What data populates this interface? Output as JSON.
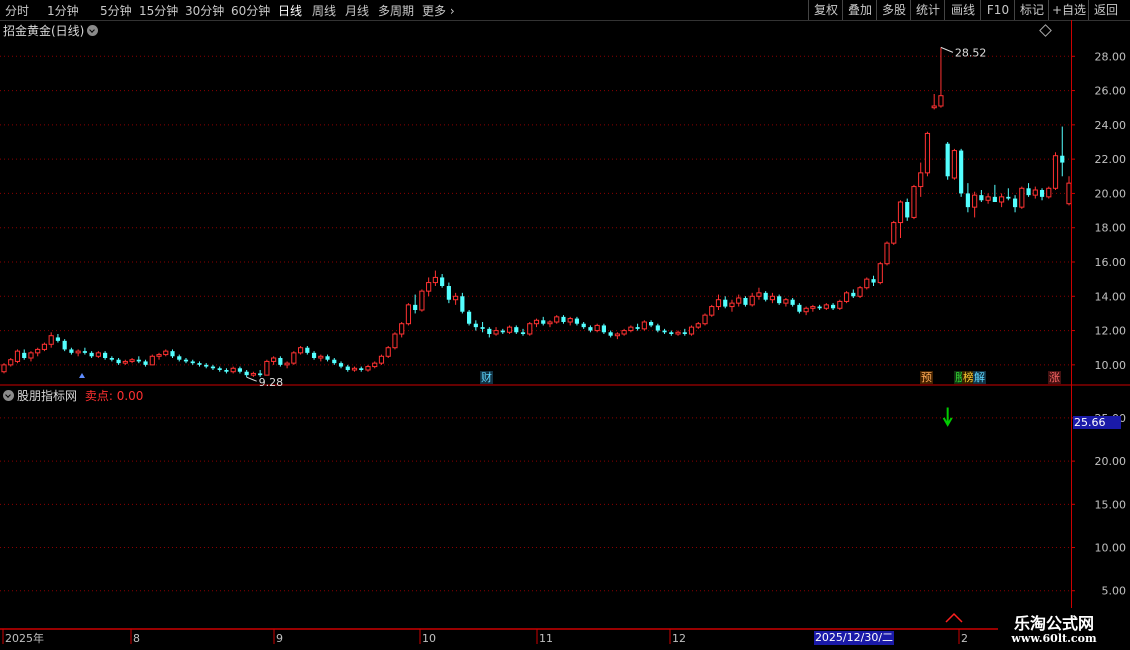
{
  "toolbar": {
    "left_items": [
      "分时",
      "1分钟",
      "5分钟",
      "15分钟",
      "30分钟",
      "60分钟",
      "日线",
      "周线",
      "月线",
      "多周期",
      "更多"
    ],
    "more_icon": "chevron-right-icon",
    "active": "日线",
    "right_items": [
      "复权",
      "叠加",
      "多股",
      "统计",
      "画线",
      "F10",
      "标记",
      "+自选",
      "返回"
    ]
  },
  "colors": {
    "up": "#ff3232",
    "down": "#54ffff",
    "grid": "#8b0000",
    "axis_text": "#c0c0c0",
    "sell_arrow": "#00cc00",
    "indicator_label": "#ff3030"
  },
  "main_panel": {
    "title": "招金黄金(日线)",
    "title_icon": "chevron-down-icon",
    "peak_label": "28.52",
    "low_label": "9.28",
    "right_icon": "diamond-icon"
  },
  "indicator_panel": {
    "name": "股朋指标网",
    "name_icon": "chevron-down-icon",
    "value_label": "卖点: 0.00",
    "current_value_tag": "25.66"
  },
  "event_badges": [
    {
      "text": "财",
      "color": "#5fd7ff"
    },
    {
      "text": "预",
      "color": "#ff9933"
    },
    {
      "text": "股",
      "color": "#33cc33"
    },
    {
      "text": "榜",
      "color": "#ffcc33"
    },
    {
      "text": "解",
      "color": "#5fd7ff"
    },
    {
      "text": "涨",
      "color": "#ff4444"
    }
  ],
  "time_axis": {
    "labels": [
      "2025年",
      "8",
      "9",
      "10",
      "11",
      "12",
      "2"
    ],
    "selected_date": "2025/12/30/二"
  },
  "watermark": {
    "title": "乐淘公式网",
    "url": "www.60lt.com"
  },
  "chart_data": [
    {
      "type": "candlestick",
      "title": "招金黄金(日线)",
      "ylim": [
        9,
        30
      ],
      "yticks": [
        10,
        12,
        14,
        16,
        18,
        20,
        22,
        24,
        26,
        28
      ],
      "ytick_labels": [
        "10.00",
        "12.00",
        "14.00",
        "16.00",
        "18.00",
        "20.00",
        "22.00",
        "24.00",
        "26.00",
        "28.00"
      ],
      "grid": true,
      "annotations": [
        {
          "label": "28.52",
          "value": 28.52
        },
        {
          "label": "9.28",
          "value": 9.28
        }
      ],
      "ohlc": [
        [
          9.6,
          10.1,
          9.5,
          10.0
        ],
        [
          10.0,
          10.4,
          9.9,
          10.3
        ],
        [
          10.2,
          10.9,
          10.1,
          10.8
        ],
        [
          10.7,
          10.9,
          10.3,
          10.4
        ],
        [
          10.4,
          10.8,
          10.2,
          10.7
        ],
        [
          10.7,
          11.0,
          10.5,
          10.9
        ],
        [
          10.9,
          11.3,
          10.8,
          11.2
        ],
        [
          11.2,
          11.9,
          11.0,
          11.7
        ],
        [
          11.6,
          11.8,
          11.3,
          11.4
        ],
        [
          11.4,
          11.5,
          10.8,
          10.9
        ],
        [
          10.9,
          11.0,
          10.6,
          10.7
        ],
        [
          10.7,
          10.9,
          10.5,
          10.8
        ],
        [
          10.8,
          11.0,
          10.6,
          10.7
        ],
        [
          10.7,
          10.8,
          10.4,
          10.5
        ],
        [
          10.5,
          10.8,
          10.4,
          10.7
        ],
        [
          10.7,
          10.8,
          10.3,
          10.4
        ],
        [
          10.4,
          10.5,
          10.2,
          10.3
        ],
        [
          10.3,
          10.4,
          10.0,
          10.1
        ],
        [
          10.1,
          10.3,
          10.0,
          10.2
        ],
        [
          10.2,
          10.4,
          10.1,
          10.3
        ],
        [
          10.3,
          10.5,
          10.1,
          10.2
        ],
        [
          10.2,
          10.3,
          9.9,
          10.0
        ],
        [
          10.0,
          10.6,
          10.0,
          10.5
        ],
        [
          10.5,
          10.7,
          10.3,
          10.6
        ],
        [
          10.6,
          10.9,
          10.5,
          10.8
        ],
        [
          10.8,
          10.9,
          10.4,
          10.5
        ],
        [
          10.5,
          10.6,
          10.2,
          10.3
        ],
        [
          10.3,
          10.4,
          10.1,
          10.2
        ],
        [
          10.2,
          10.3,
          10.0,
          10.1
        ],
        [
          10.1,
          10.2,
          9.9,
          10.0
        ],
        [
          10.0,
          10.1,
          9.8,
          9.9
        ],
        [
          9.9,
          10.0,
          9.7,
          9.8
        ],
        [
          9.8,
          9.9,
          9.6,
          9.7
        ],
        [
          9.7,
          9.8,
          9.5,
          9.6
        ],
        [
          9.6,
          9.9,
          9.5,
          9.8
        ],
        [
          9.8,
          9.9,
          9.5,
          9.6
        ],
        [
          9.6,
          9.7,
          9.28,
          9.4
        ],
        [
          9.4,
          9.6,
          9.3,
          9.5
        ],
        [
          9.5,
          9.7,
          9.3,
          9.4
        ],
        [
          9.4,
          10.3,
          9.4,
          10.2
        ],
        [
          10.2,
          10.5,
          10.0,
          10.4
        ],
        [
          10.4,
          10.5,
          9.9,
          10.0
        ],
        [
          10.0,
          10.2,
          9.8,
          10.1
        ],
        [
          10.1,
          10.8,
          10.0,
          10.7
        ],
        [
          10.7,
          11.1,
          10.6,
          11.0
        ],
        [
          11.0,
          11.1,
          10.6,
          10.7
        ],
        [
          10.7,
          10.8,
          10.3,
          10.4
        ],
        [
          10.4,
          10.6,
          10.2,
          10.5
        ],
        [
          10.5,
          10.6,
          10.2,
          10.3
        ],
        [
          10.3,
          10.4,
          10.0,
          10.1
        ],
        [
          10.1,
          10.2,
          9.8,
          9.9
        ],
        [
          9.9,
          10.0,
          9.6,
          9.7
        ],
        [
          9.7,
          9.9,
          9.6,
          9.8
        ],
        [
          9.8,
          9.9,
          9.6,
          9.7
        ],
        [
          9.7,
          10.0,
          9.6,
          9.9
        ],
        [
          9.9,
          10.2,
          9.8,
          10.1
        ],
        [
          10.1,
          10.6,
          10.0,
          10.5
        ],
        [
          10.5,
          11.1,
          10.4,
          11.0
        ],
        [
          11.0,
          11.9,
          10.9,
          11.8
        ],
        [
          11.8,
          12.5,
          11.6,
          12.4
        ],
        [
          12.4,
          13.6,
          12.3,
          13.5
        ],
        [
          13.5,
          14.1,
          13.0,
          13.2
        ],
        [
          13.2,
          14.4,
          13.1,
          14.3
        ],
        [
          14.3,
          15.1,
          14.0,
          14.8
        ],
        [
          14.8,
          15.5,
          14.6,
          15.1
        ],
        [
          15.1,
          15.3,
          14.5,
          14.6
        ],
        [
          14.6,
          14.8,
          13.6,
          13.8
        ],
        [
          13.8,
          14.2,
          13.5,
          14.0
        ],
        [
          14.0,
          14.2,
          13.0,
          13.1
        ],
        [
          13.1,
          13.2,
          12.3,
          12.4
        ],
        [
          12.4,
          12.6,
          12.0,
          12.2
        ],
        [
          12.2,
          12.5,
          11.9,
          12.1
        ],
        [
          12.1,
          12.2,
          11.6,
          11.8
        ],
        [
          11.8,
          12.2,
          11.7,
          12.0
        ],
        [
          12.0,
          12.1,
          11.8,
          11.9
        ],
        [
          11.9,
          12.3,
          11.8,
          12.2
        ],
        [
          12.2,
          12.3,
          11.8,
          11.9
        ],
        [
          11.9,
          12.1,
          11.7,
          11.8
        ],
        [
          11.8,
          12.5,
          11.7,
          12.4
        ],
        [
          12.4,
          12.7,
          12.2,
          12.6
        ],
        [
          12.6,
          12.8,
          12.3,
          12.4
        ],
        [
          12.4,
          12.6,
          12.2,
          12.5
        ],
        [
          12.5,
          12.9,
          12.4,
          12.8
        ],
        [
          12.8,
          12.9,
          12.4,
          12.5
        ],
        [
          12.5,
          12.8,
          12.3,
          12.7
        ],
        [
          12.7,
          12.8,
          12.3,
          12.4
        ],
        [
          12.4,
          12.5,
          12.1,
          12.2
        ],
        [
          12.2,
          12.3,
          11.9,
          12.0
        ],
        [
          12.0,
          12.4,
          11.9,
          12.3
        ],
        [
          12.3,
          12.4,
          11.8,
          11.9
        ],
        [
          11.9,
          12.0,
          11.6,
          11.7
        ],
        [
          11.7,
          11.9,
          11.5,
          11.8
        ],
        [
          11.8,
          12.1,
          11.7,
          12.0
        ],
        [
          12.0,
          12.3,
          11.9,
          12.2
        ],
        [
          12.2,
          12.4,
          12.0,
          12.1
        ],
        [
          12.1,
          12.6,
          12.0,
          12.5
        ],
        [
          12.5,
          12.6,
          12.2,
          12.3
        ],
        [
          12.3,
          12.4,
          11.9,
          12.0
        ],
        [
          12.0,
          12.1,
          11.8,
          11.9
        ],
        [
          11.9,
          12.0,
          11.7,
          11.8
        ],
        [
          11.8,
          12.0,
          11.7,
          11.9
        ],
        [
          11.9,
          12.1,
          11.7,
          11.8
        ],
        [
          11.8,
          12.3,
          11.7,
          12.2
        ],
        [
          12.2,
          12.5,
          12.1,
          12.4
        ],
        [
          12.4,
          13.0,
          12.3,
          12.9
        ],
        [
          12.9,
          13.5,
          12.8,
          13.4
        ],
        [
          13.4,
          14.1,
          13.2,
          13.8
        ],
        [
          13.8,
          14.0,
          13.3,
          13.4
        ],
        [
          13.4,
          13.8,
          13.1,
          13.6
        ],
        [
          13.6,
          14.1,
          13.4,
          13.9
        ],
        [
          13.9,
          14.0,
          13.4,
          13.5
        ],
        [
          13.5,
          14.2,
          13.4,
          14.0
        ],
        [
          14.0,
          14.5,
          13.8,
          14.2
        ],
        [
          14.2,
          14.3,
          13.7,
          13.8
        ],
        [
          13.8,
          14.2,
          13.6,
          14.0
        ],
        [
          14.0,
          14.1,
          13.5,
          13.6
        ],
        [
          13.6,
          13.9,
          13.4,
          13.8
        ],
        [
          13.8,
          13.9,
          13.4,
          13.5
        ],
        [
          13.5,
          13.6,
          13.0,
          13.1
        ],
        [
          13.1,
          13.4,
          12.9,
          13.3
        ],
        [
          13.3,
          13.5,
          13.1,
          13.4
        ],
        [
          13.4,
          13.5,
          13.2,
          13.3
        ],
        [
          13.3,
          13.6,
          13.2,
          13.5
        ],
        [
          13.5,
          13.6,
          13.2,
          13.3
        ],
        [
          13.3,
          13.8,
          13.2,
          13.7
        ],
        [
          13.7,
          14.3,
          13.6,
          14.2
        ],
        [
          14.2,
          14.4,
          13.9,
          14.0
        ],
        [
          14.0,
          14.6,
          13.9,
          14.5
        ],
        [
          14.5,
          15.1,
          14.4,
          15.0
        ],
        [
          15.0,
          15.2,
          14.6,
          14.8
        ],
        [
          14.8,
          16.0,
          14.7,
          15.9
        ],
        [
          15.9,
          17.2,
          15.8,
          17.1
        ],
        [
          17.1,
          18.4,
          17.0,
          18.3
        ],
        [
          18.3,
          19.6,
          17.4,
          19.5
        ],
        [
          19.5,
          19.7,
          18.4,
          18.6
        ],
        [
          18.6,
          20.5,
          18.5,
          20.4
        ],
        [
          20.4,
          21.8,
          19.8,
          21.2
        ],
        [
          21.2,
          23.6,
          21.0,
          23.5
        ],
        [
          25.0,
          25.8,
          24.9,
          25.1
        ],
        [
          25.1,
          28.52,
          25.0,
          25.7
        ],
        [
          22.9,
          23.0,
          20.8,
          21.0
        ],
        [
          20.9,
          22.6,
          20.8,
          22.5
        ],
        [
          22.5,
          22.6,
          19.8,
          20.0
        ],
        [
          20.0,
          20.6,
          18.9,
          19.2
        ],
        [
          19.2,
          20.1,
          18.6,
          19.9
        ],
        [
          19.9,
          20.2,
          19.5,
          19.6
        ],
        [
          19.6,
          20.0,
          19.4,
          19.8
        ],
        [
          19.8,
          20.5,
          19.6,
          19.5
        ],
        [
          19.5,
          20.0,
          19.2,
          19.8
        ],
        [
          19.8,
          20.3,
          19.6,
          19.7
        ],
        [
          19.7,
          19.9,
          18.9,
          19.2
        ],
        [
          19.2,
          20.4,
          19.1,
          20.3
        ],
        [
          20.3,
          20.6,
          19.8,
          19.9
        ],
        [
          19.9,
          20.4,
          19.7,
          20.2
        ],
        [
          20.2,
          20.3,
          19.6,
          19.8
        ],
        [
          19.8,
          20.4,
          19.7,
          20.3
        ],
        [
          20.3,
          22.4,
          20.2,
          22.2
        ],
        [
          22.2,
          23.9,
          21.0,
          21.8
        ],
        [
          19.4,
          21.0,
          19.3,
          20.6
        ]
      ]
    },
    {
      "type": "line",
      "title": "股朋指标网",
      "ylim": [
        3,
        28
      ],
      "yticks": [
        5,
        10,
        15,
        20,
        25
      ],
      "ytick_labels": [
        "5.00",
        "10.00",
        "15.00",
        "20.00",
        "25.00"
      ],
      "grid": true,
      "series": [
        {
          "name": "卖点",
          "last_value": 0.0,
          "current_value": 25.66
        }
      ],
      "signals": [
        {
          "type": "sell",
          "arrow": "down",
          "label": "卖点"
        }
      ]
    }
  ]
}
